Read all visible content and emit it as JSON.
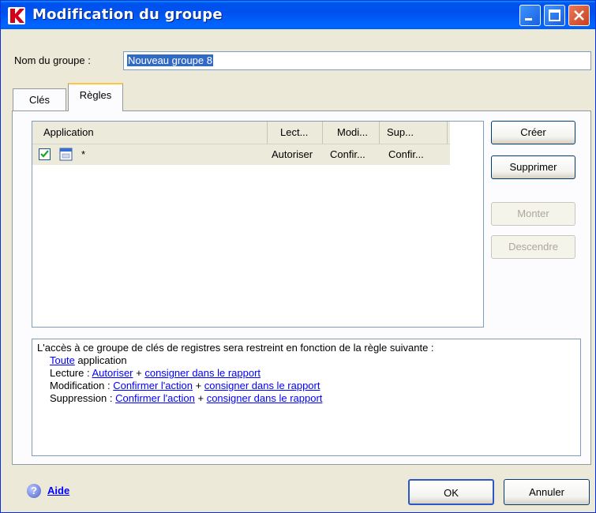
{
  "window": {
    "title": "Modification du groupe"
  },
  "form": {
    "name_label": "Nom du groupe :",
    "name_value": "Nouveau groupe 8"
  },
  "tabs": [
    {
      "label": "Clés",
      "selected": false
    },
    {
      "label": "Règles",
      "selected": true
    }
  ],
  "list": {
    "columns": [
      "Application",
      "Lect...",
      "Modi...",
      "Sup..."
    ],
    "rows": [
      {
        "checked": true,
        "icon": "application-icon",
        "application": "*",
        "read": "Autoriser",
        "modify": "Confir...",
        "delete": "Confir..."
      }
    ]
  },
  "side_buttons": {
    "create": "Créer",
    "delete": "Supprimer",
    "up": "Monter",
    "down": "Descendre"
  },
  "description": {
    "intro": "L'accès à ce groupe de clés de registres sera restreint en fonction de la règle suivante :",
    "line1_link": "Toute",
    "line1_text": " application",
    "line2_label": "Lecture : ",
    "line2_link1": "Autoriser",
    "line2_plus": " + ",
    "line2_link2": "consigner dans le rapport",
    "line3_label": "Modification : ",
    "line3_link1": "Confirmer l'action",
    "line3_plus": " + ",
    "line3_link2": "consigner dans le rapport",
    "line4_label": "Suppression : ",
    "line4_link1": "Confirmer l'action",
    "line4_plus": " + ",
    "line4_link2": "consigner dans le rapport"
  },
  "footer": {
    "help_label": "Aide",
    "ok_label": "OK",
    "cancel_label": "Annuler"
  },
  "colors": {
    "titlebar": "#0053ee",
    "dialog_bg": "#ece9d8",
    "link": "#0000ff",
    "selection": "#316ac5"
  }
}
